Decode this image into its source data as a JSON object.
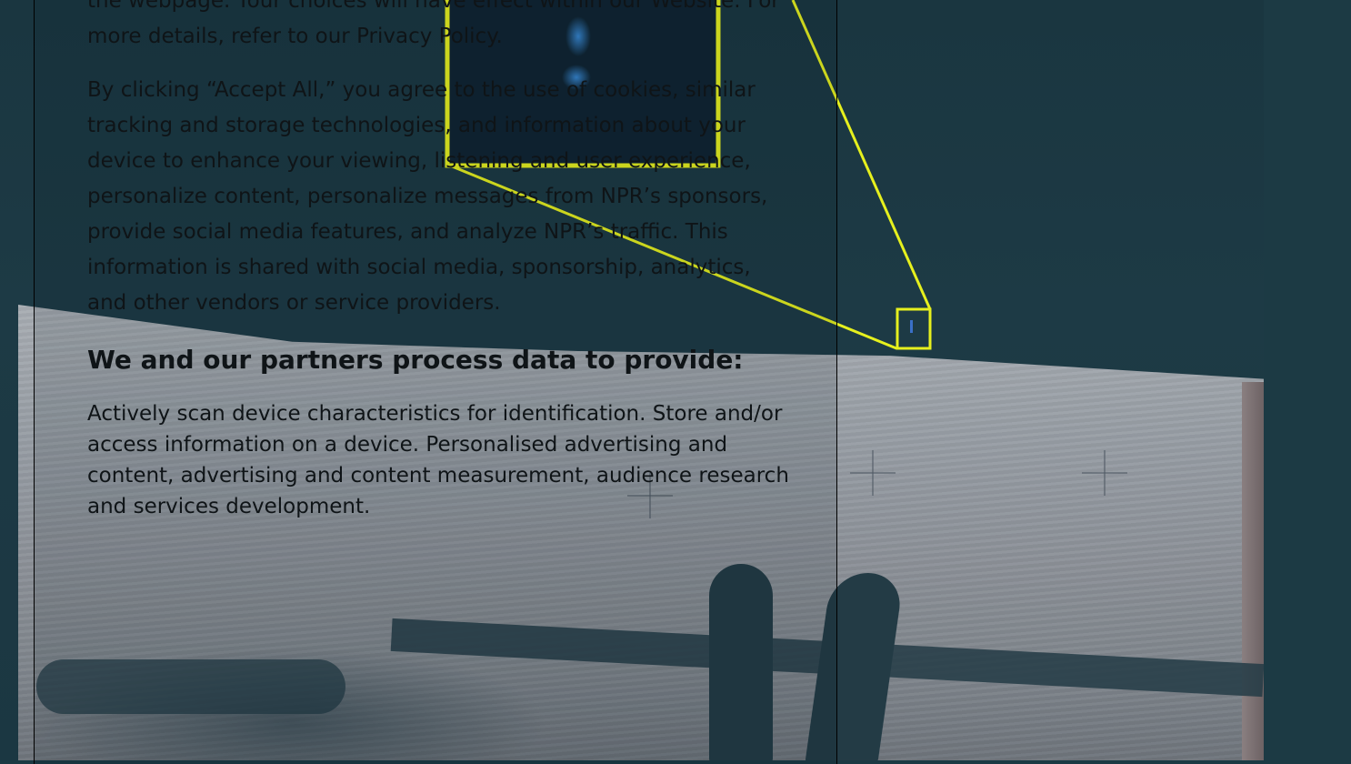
{
  "consent_panel": {
    "paragraph_1": "the webpage. Your choices will have effect within our Website. For more details, refer to our Privacy Policy.",
    "paragraph_2": "By clicking “Accept All,” you agree to the use of cookies, similar tracking and storage technologies, and information about your device to enhance your viewing, listening and user experience, personalize content, personalize messages from NPR’s sponsors, provide social media features, and analyze NPR’s traffic. This information is shared with social media, sponsorship, analytics, and other vendors or service providers.",
    "heading": "We and our partners process data to provide:",
    "purposes_text": "Actively scan device characteristics for identification. Store and/or access information on a device. Personalised advertising and content, advertising and content measurement, audience research and services development."
  },
  "colors": {
    "annotation_yellow": "#e6f01e",
    "sky": "#1b3a44",
    "text": "#0f1417"
  }
}
